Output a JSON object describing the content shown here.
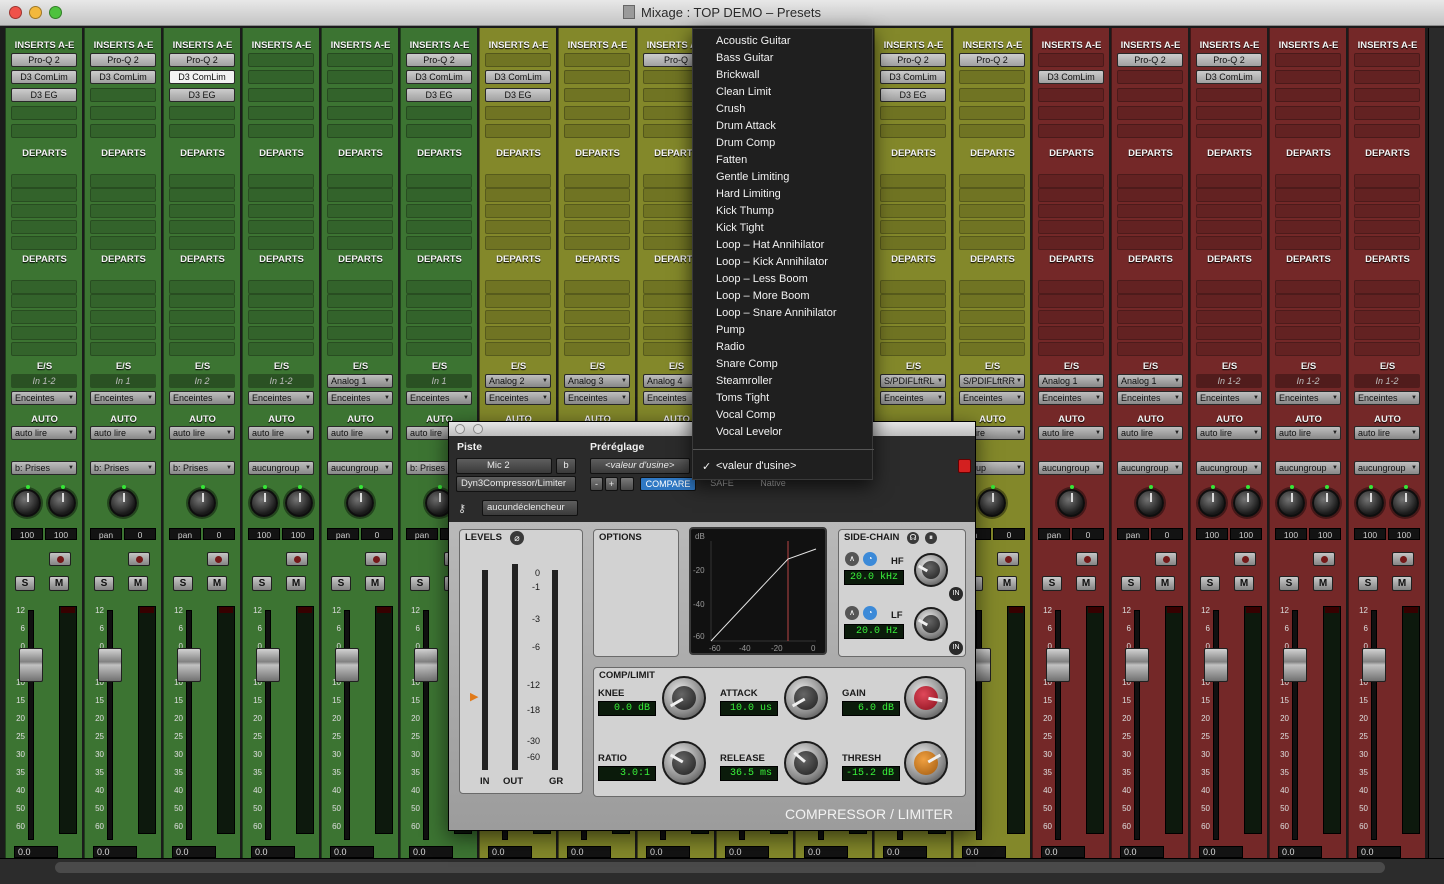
{
  "window": {
    "title": "Mixage : TOP DEMO – Presets"
  },
  "headers": {
    "inserts": "INSERTS A-E",
    "departs": "DEPARTS",
    "es": "E/S",
    "auto": "AUTO"
  },
  "strips": [
    {
      "color": "#3f7a35",
      "inserts": [
        "Pro-Q 2",
        "D3 ComLim",
        "D3 EG"
      ],
      "sel": -1,
      "input": "In 1-2",
      "input_dd": false,
      "output": "Enceintes",
      "auto": "auto lire",
      "group": "b: Prises",
      "knobs": 2,
      "pan": [
        "100",
        "100"
      ]
    },
    {
      "color": "#3f7a35",
      "inserts": [
        "Pro-Q 2",
        "D3 ComLim"
      ],
      "sel": -1,
      "input": "In 1",
      "input_dd": false,
      "output": "Enceintes",
      "auto": "auto lire",
      "group": "b: Prises",
      "knobs": 1,
      "pan": [
        "pan",
        "0"
      ]
    },
    {
      "color": "#3f7a35",
      "inserts": [
        "Pro-Q 2",
        "D3 ComLim",
        "D3 EG"
      ],
      "sel": 1,
      "input": "In 2",
      "input_dd": false,
      "output": "Enceintes",
      "auto": "auto lire",
      "group": "b: Prises",
      "knobs": 1,
      "pan": [
        "pan",
        "0"
      ]
    },
    {
      "color": "#3f7a35",
      "inserts": [],
      "sel": -1,
      "input": "In 1-2",
      "input_dd": false,
      "output": "Enceintes",
      "auto": "auto lire",
      "group": "aucungroup",
      "knobs": 2,
      "pan": [
        "100",
        "100"
      ]
    },
    {
      "color": "#3f7a35",
      "inserts": [],
      "sel": -1,
      "input": "Analog 1",
      "input_dd": true,
      "output": "Enceintes",
      "auto": "auto lire",
      "group": "aucungroup",
      "knobs": 1,
      "pan": [
        "pan",
        "0"
      ]
    },
    {
      "color": "#3f7a35",
      "inserts": [
        "Pro-Q 2",
        "D3 ComLim",
        "D3 EG"
      ],
      "sel": -1,
      "input": "In 1",
      "input_dd": false,
      "output": "Enceintes",
      "auto": "auto lire",
      "group": "b: Prises",
      "knobs": 1,
      "pan": [
        "pan",
        "0"
      ]
    },
    {
      "color": "#8a8f2c",
      "inserts": [
        "",
        "D3 ComLim",
        "D3 EG"
      ],
      "sel": -1,
      "input": "Analog 2",
      "input_dd": true,
      "output": "Enceintes",
      "auto": "AUTO",
      "group": "",
      "knobs": 0,
      "pan": [
        "",
        ""
      ]
    },
    {
      "color": "#8a8f2c",
      "inserts": [],
      "sel": -1,
      "input": "Analog 3",
      "input_dd": true,
      "output": "Enceintes",
      "auto": "AUTO",
      "group": "",
      "knobs": 0,
      "pan": [
        "",
        ""
      ]
    },
    {
      "color": "#8a8f2c",
      "inserts": [
        "Pro-Q"
      ],
      "sel": -1,
      "input": "Analog 4",
      "input_dd": true,
      "output": "Enceintes",
      "auto": "AUTO",
      "group": "",
      "knobs": 0,
      "pan": [
        "",
        ""
      ]
    },
    {
      "color": "#8a8f2c",
      "inserts": [],
      "sel": -1,
      "input": "",
      "input_dd": false,
      "output": "",
      "auto": "",
      "group": "",
      "knobs": 0,
      "pan": [
        "",
        ""
      ]
    },
    {
      "color": "#8a8f2c",
      "inserts": [],
      "sel": -1,
      "input": "",
      "input_dd": false,
      "output": "",
      "auto": "",
      "group": "",
      "knobs": 0,
      "pan": [
        "",
        ""
      ]
    },
    {
      "color": "#8a8f2c",
      "inserts": [
        "Pro-Q 2",
        "D3 ComLim",
        "D3 EG"
      ],
      "sel": -1,
      "input": "S/PDIFLftRL",
      "input_dd": true,
      "output": "Enceintes",
      "auto": "",
      "group": "",
      "knobs": 0,
      "pan": [
        "",
        ""
      ]
    },
    {
      "color": "#8a8f2c",
      "inserts": [
        "Pro-Q 2"
      ],
      "sel": -1,
      "input": "S/PDIFLftRR",
      "input_dd": true,
      "output": "Enceintes",
      "auto": "to lire",
      "group": "group",
      "knobs": 1,
      "pan": [
        "n",
        "0"
      ]
    },
    {
      "color": "#7a2a2a",
      "inserts": [
        "",
        "D3 ComLim"
      ],
      "sel": -1,
      "input": "Analog 1",
      "input_dd": true,
      "output": "Enceintes",
      "auto": "auto lire",
      "group": "aucungroup",
      "knobs": 1,
      "pan": [
        "pan",
        "0"
      ]
    },
    {
      "color": "#7a2a2a",
      "inserts": [
        "Pro-Q 2"
      ],
      "sel": -1,
      "input": "Analog 1",
      "input_dd": true,
      "output": "Enceintes",
      "auto": "auto lire",
      "group": "aucungroup",
      "knobs": 1,
      "pan": [
        "pan",
        "0"
      ]
    },
    {
      "color": "#7a2a2a",
      "inserts": [
        "Pro-Q 2",
        "D3 ComLim"
      ],
      "sel": -1,
      "input": "In 1-2",
      "input_dd": false,
      "output": "Enceintes",
      "auto": "auto lire",
      "group": "aucungroup",
      "knobs": 2,
      "pan": [
        "100",
        "100"
      ]
    },
    {
      "color": "#7a2a2a",
      "inserts": [],
      "sel": -1,
      "input": "In 1-2",
      "input_dd": false,
      "output": "Enceintes",
      "auto": "auto lire",
      "group": "aucungroup",
      "knobs": 2,
      "pan": [
        "100",
        "100"
      ]
    },
    {
      "color": "#7a2a2a",
      "inserts": [],
      "sel": -1,
      "input": "In 1-2",
      "input_dd": false,
      "output": "Enceintes",
      "auto": "auto lire",
      "group": "aucungroup",
      "knobs": 2,
      "pan": [
        "100",
        "100"
      ]
    }
  ],
  "strip_common": {
    "solo": "S",
    "mute": "M",
    "volume": "0.0",
    "scale": [
      "12",
      "6",
      "0",
      "5",
      "10",
      "15",
      "20",
      "25",
      "30",
      "35",
      "40",
      "50",
      "60"
    ]
  },
  "plugin": {
    "track_label": "Piste",
    "preset_label": "Préréglage",
    "track": "Mic 2",
    "track_variant": "b",
    "plugin_name": "Dyn3Compressor/Limiter",
    "preset": "<valeur d'usine>",
    "minus": "-",
    "plus": "+",
    "compare": "COMPARE",
    "safe": "SAFE",
    "native": "Native",
    "key_input": "aucundéclencheur",
    "levels": {
      "title": "LEVELS",
      "scale": [
        "0",
        "-1",
        "-3",
        "-6",
        "-12",
        "-18",
        "-30",
        "-60"
      ],
      "in": "IN",
      "out": "OUT",
      "gr": "GR"
    },
    "options_title": "OPTIONS",
    "graph": {
      "y_labels": [
        "dB",
        "-20",
        "-40",
        "-60"
      ],
      "x_labels": [
        "-60",
        "-40",
        "-20",
        "0"
      ]
    },
    "sidechain": {
      "title": "SIDE-CHAIN",
      "hf_label": "HF",
      "hf_value": "20.0 kHz",
      "lf_label": "LF",
      "lf_value": "20.0 Hz",
      "in": "IN"
    },
    "comp": {
      "title": "COMP/LIMIT",
      "knee_label": "KNEE",
      "knee": "0.0 dB",
      "attack_label": "ATTACK",
      "attack": "10.0 us",
      "gain_label": "GAIN",
      "gain": "6.0 dB",
      "ratio_label": "RATIO",
      "ratio": "3.0:1",
      "release_label": "RELEASE",
      "release": "36.5 ms",
      "thresh_label": "THRESH",
      "thresh": "-15.2 dB"
    },
    "branding": "COMPRESSOR / LIMITER"
  },
  "preset_menu": {
    "items": [
      "Acoustic Guitar",
      "Bass Guitar",
      "Brickwall",
      "Clean Limit",
      "Crush",
      "Drum Attack",
      "Drum Comp",
      "Fatten",
      "Gentle Limiting",
      "Hard Limiting",
      "Kick Thump",
      "Kick Tight",
      "Loop – Hat Annihilator",
      "Loop – Kick Annihilator",
      "Loop – Less Boom",
      "Loop – More Boom",
      "Loop – Snare Annihilator",
      "Pump",
      "Radio",
      "Snare Comp",
      "Steamroller",
      "Toms Tight",
      "Vocal Comp",
      "Vocal Levelor"
    ],
    "checked": "<valeur d'usine>",
    "check_mark": "✓"
  }
}
